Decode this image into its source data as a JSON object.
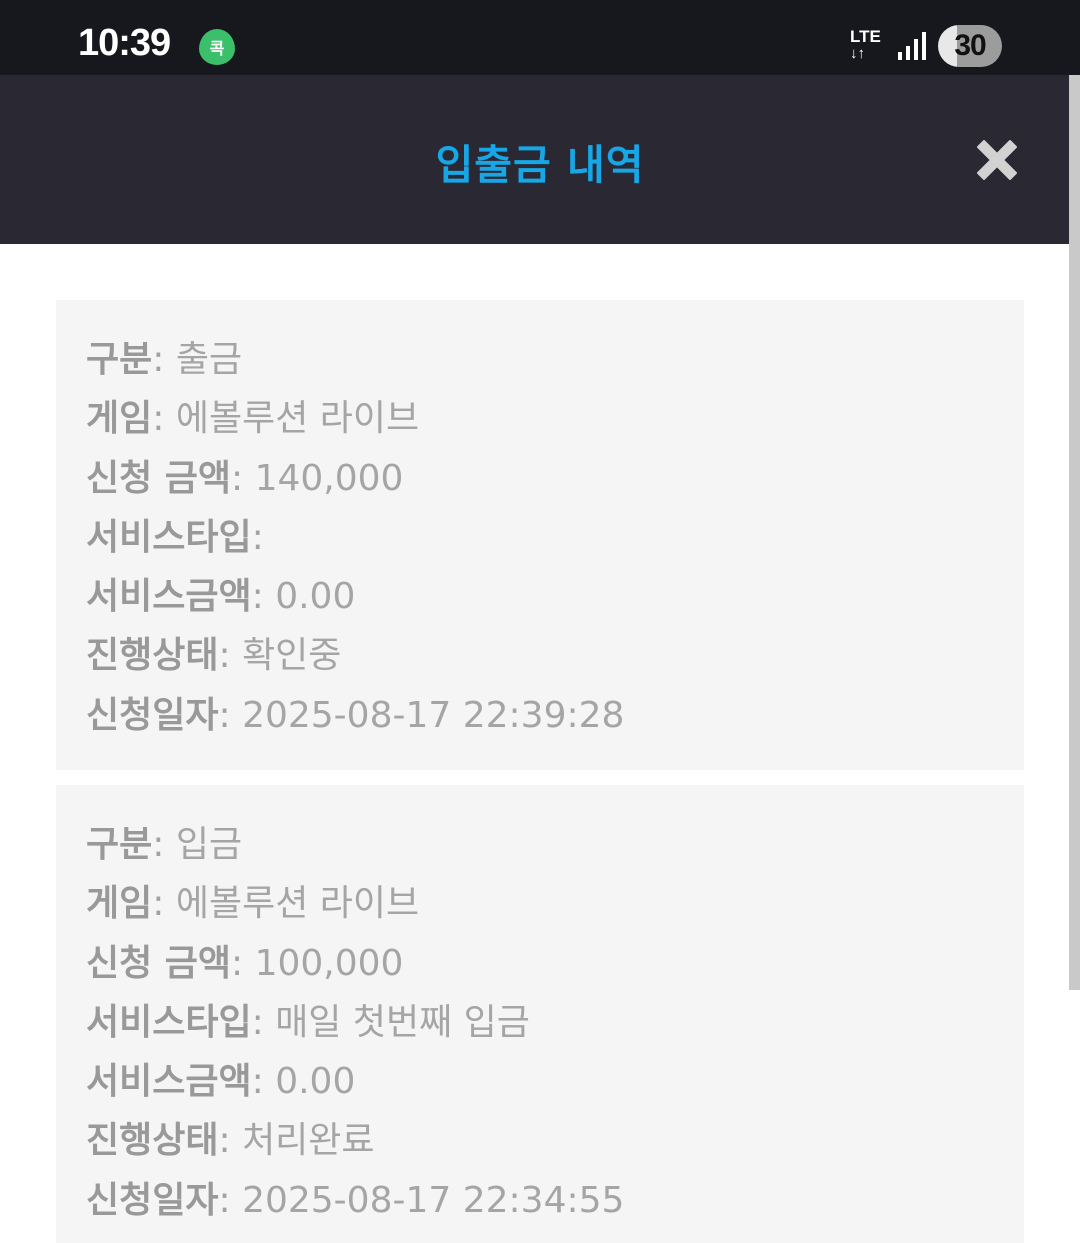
{
  "status_bar": {
    "time": "10:39",
    "app_badge": "콕",
    "network": "LTE",
    "network_arrows": "↓↑",
    "battery": "30"
  },
  "header": {
    "title": "입출금 내역",
    "close_icon": "close-x-icon"
  },
  "colors": {
    "status_bar_bg": "#17171e",
    "header_bg": "#292833",
    "title": "#17a7e6",
    "card_bg": "#f5f5f5",
    "text": "#a2a2a2"
  },
  "sep": ": ",
  "records": [
    {
      "type_label": "구분",
      "type": "출금",
      "game_label": "게임",
      "game": "에볼루션 라이브",
      "amount_label": "신청 금액",
      "amount": "140,000",
      "service_type_label": "서비스타입",
      "service_type": "",
      "service_amount_label": "서비스금액",
      "service_amount": "0.00",
      "status_label": "진행상태",
      "status": "확인중",
      "date_label": "신청일자",
      "date": "2025-08-17 22:39:28"
    },
    {
      "type_label": "구분",
      "type": "입금",
      "game_label": "게임",
      "game": "에볼루션 라이브",
      "amount_label": "신청 금액",
      "amount": "100,000",
      "service_type_label": "서비스타입",
      "service_type": "매일 첫번째 입금",
      "service_amount_label": "서비스금액",
      "service_amount": "0.00",
      "status_label": "진행상태",
      "status": "처리완료",
      "date_label": "신청일자",
      "date": "2025-08-17 22:34:55"
    }
  ]
}
